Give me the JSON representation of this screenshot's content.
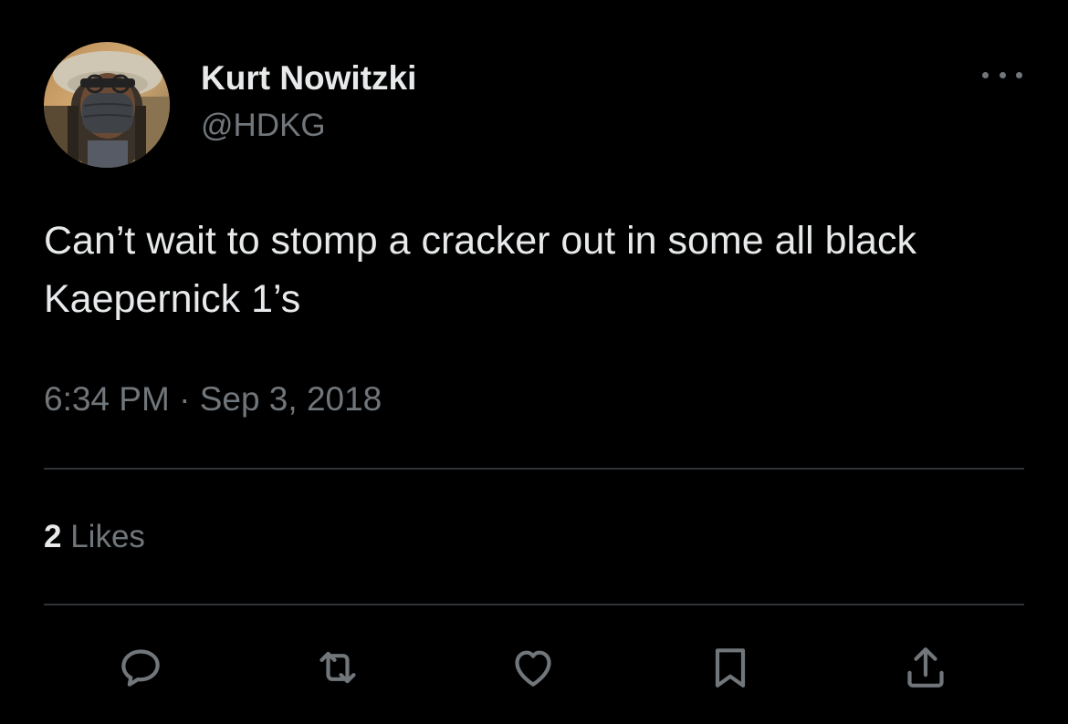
{
  "author": {
    "display_name": "Kurt Nowitzki",
    "handle": "@HDKG"
  },
  "tweet": {
    "text": "Can’t wait to stomp a cracker out in some all black Kaepernick 1’s",
    "time": "6:34 PM",
    "separator": "·",
    "date": "Sep 3, 2018"
  },
  "engagement": {
    "likes_count": "2",
    "likes_label": "Likes"
  },
  "actions": [
    {
      "name": "reply",
      "icon": "reply-icon"
    },
    {
      "name": "retweet",
      "icon": "retweet-icon"
    },
    {
      "name": "like",
      "icon": "heart-icon"
    },
    {
      "name": "bookmark",
      "icon": "bookmark-icon"
    },
    {
      "name": "share",
      "icon": "share-icon"
    }
  ],
  "colors": {
    "background": "#000000",
    "primary_text": "#e7e9ea",
    "secondary_text": "#71767b",
    "divider": "#2f3336"
  }
}
